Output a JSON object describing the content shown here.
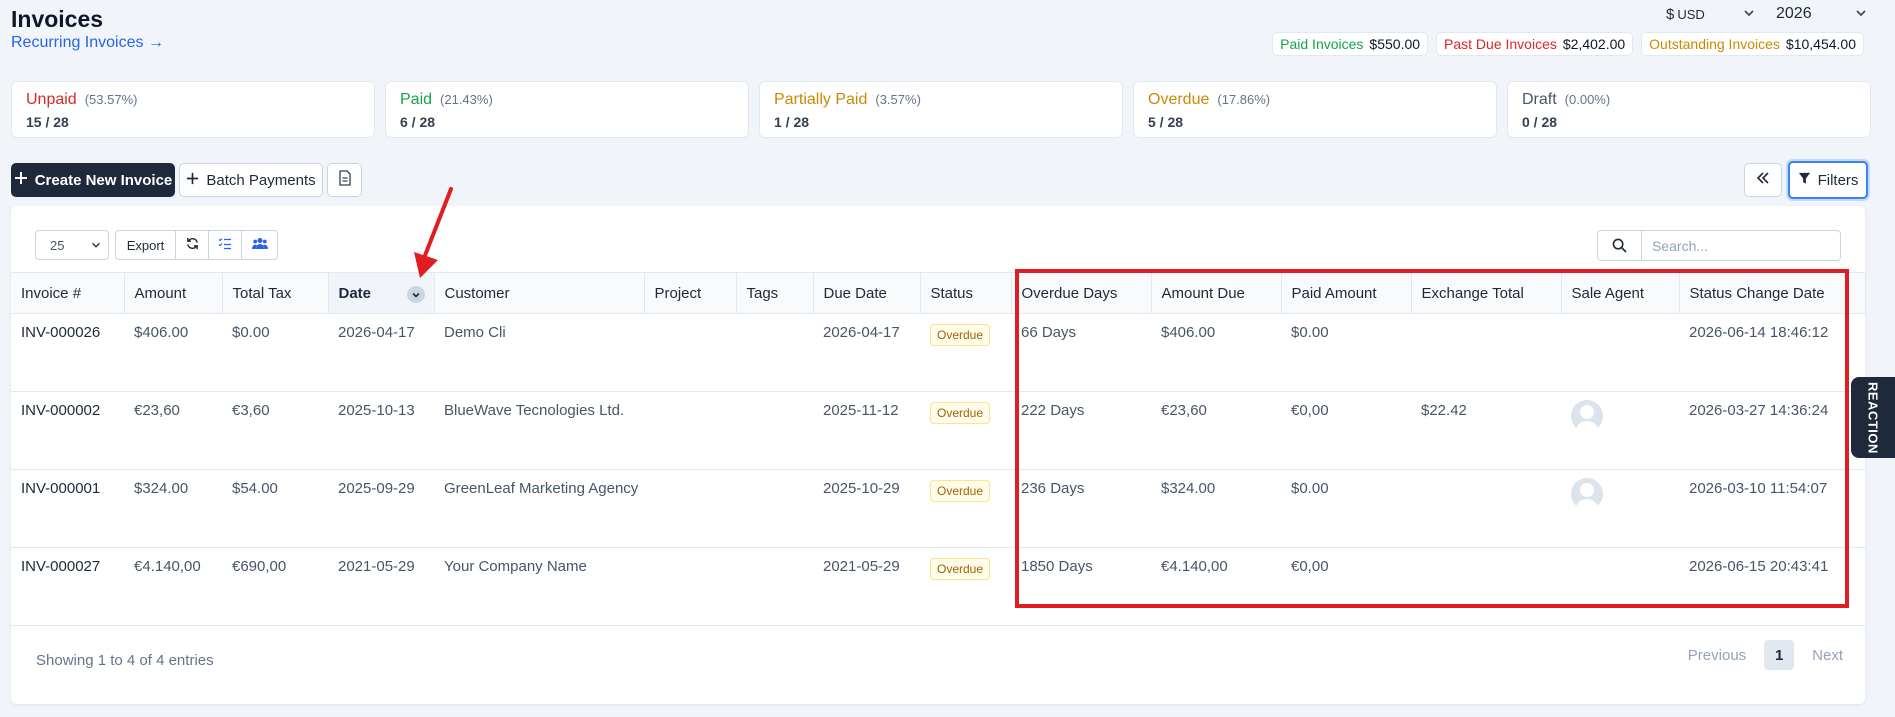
{
  "header": {
    "title": "Invoices",
    "recurring_link": "Recurring Invoices →",
    "currency_symbol": "$",
    "currency": "USD",
    "year": "2026"
  },
  "totals": [
    {
      "label": "Paid Invoices",
      "amount": "$550.00",
      "color": "#16a34a"
    },
    {
      "label": "Past Due Invoices",
      "amount": "$2,402.00",
      "color": "#dc2626"
    },
    {
      "label": "Outstanding Invoices",
      "amount": "$10,454.00",
      "color": "#ca8a04"
    }
  ],
  "stats": [
    {
      "label": "Unpaid",
      "pct": "(53.57%)",
      "count": "15 / 28",
      "color": "#dc2626"
    },
    {
      "label": "Paid",
      "pct": "(21.43%)",
      "count": "6 / 28",
      "color": "#16a34a"
    },
    {
      "label": "Partially Paid",
      "pct": "(3.57%)",
      "count": "1 / 28",
      "color": "#ca8a04"
    },
    {
      "label": "Overdue",
      "pct": "(17.86%)",
      "count": "5 / 28",
      "color": "#ca8a04"
    },
    {
      "label": "Draft",
      "pct": "(0.00%)",
      "count": "0 / 28",
      "color": "#475569"
    }
  ],
  "toolbar": {
    "create_label": "Create New Invoice",
    "batch_label": "Batch Payments",
    "filters_label": "Filters"
  },
  "table_controls": {
    "page_size": "25",
    "export_label": "Export",
    "search_placeholder": "Search..."
  },
  "columns": [
    "Invoice #",
    "Amount",
    "Total Tax",
    "Date",
    "Customer",
    "Project",
    "Tags",
    "Due Date",
    "Status",
    "Overdue Days",
    "Amount Due",
    "Paid Amount",
    "Exchange Total",
    "Sale Agent",
    "Status Change Date"
  ],
  "rows": [
    {
      "invoice": "INV-000026",
      "amount": "$406.00",
      "tax": "$0.00",
      "date": "2026-04-17",
      "customer": "Demo Cli",
      "project": "",
      "tags": "",
      "due_date": "2026-04-17",
      "status": "Overdue",
      "overdue_days": "66 Days",
      "amount_due": "$406.00",
      "paid_amount": "$0.00",
      "exchange_total": "",
      "has_agent": false,
      "status_change": "2026-06-14 18:46:12"
    },
    {
      "invoice": "INV-000002",
      "amount": "€23,60",
      "tax": "€3,60",
      "date": "2025-10-13",
      "customer": "BlueWave Tecnologies Ltd.",
      "project": "",
      "tags": "",
      "due_date": "2025-11-12",
      "status": "Overdue",
      "overdue_days": "222 Days",
      "amount_due": "€23,60",
      "paid_amount": "€0,00",
      "exchange_total": "$22.42",
      "has_agent": true,
      "status_change": "2026-03-27 14:36:24"
    },
    {
      "invoice": "INV-000001",
      "amount": "$324.00",
      "tax": "$54.00",
      "date": "2025-09-29",
      "customer": "GreenLeaf Marketing Agency",
      "project": "",
      "tags": "",
      "due_date": "2025-10-29",
      "status": "Overdue",
      "overdue_days": "236 Days",
      "amount_due": "$324.00",
      "paid_amount": "$0.00",
      "exchange_total": "",
      "has_agent": true,
      "status_change": "2026-03-10 11:54:07"
    },
    {
      "invoice": "INV-000027",
      "amount": "€4.140,00",
      "tax": "€690,00",
      "date": "2021-05-29",
      "customer": "Your Company Name",
      "project": "",
      "tags": "",
      "due_date": "2021-05-29",
      "status": "Overdue",
      "overdue_days": "1850 Days",
      "amount_due": "€4.140,00",
      "paid_amount": "€0,00",
      "exchange_total": "",
      "has_agent": false,
      "status_change": "2026-06-15 20:43:41"
    }
  ],
  "footer": {
    "info": "Showing 1 to 4 of 4 entries",
    "previous": "Previous",
    "current_page": "1",
    "next": "Next"
  },
  "side_tab": "REACTION",
  "annotation_color": "#e11d24"
}
